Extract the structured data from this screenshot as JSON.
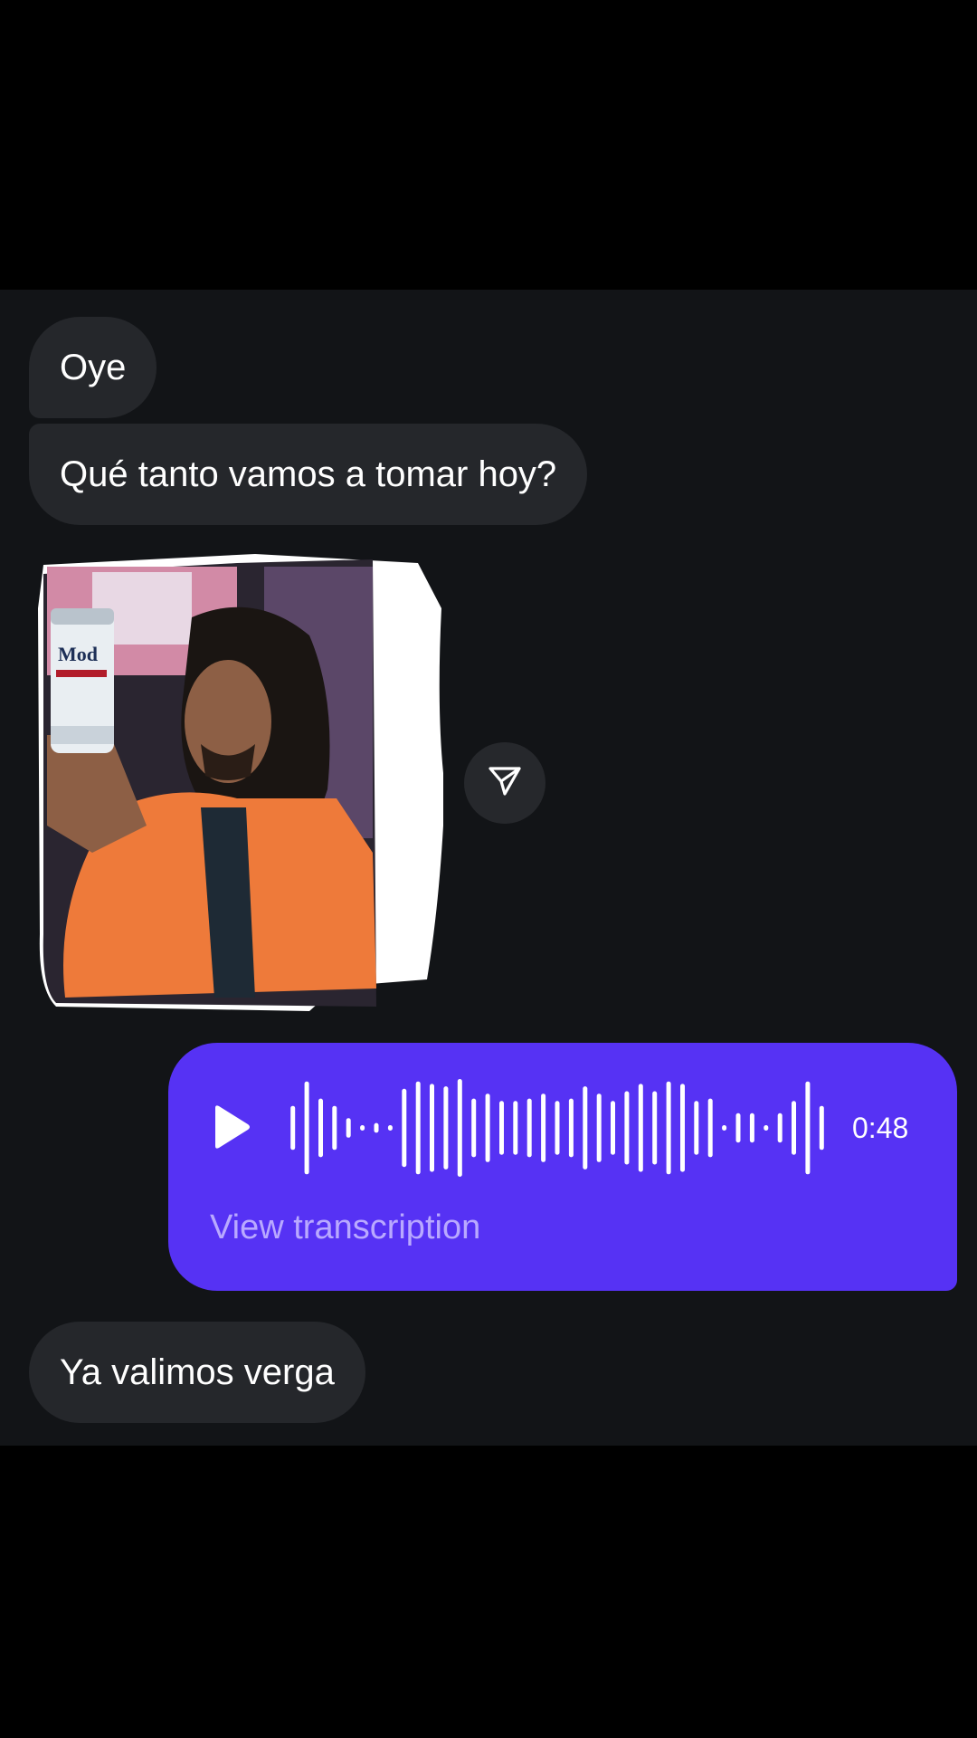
{
  "messages": {
    "first": "Oye",
    "second": "Qué tanto vamos a tomar hoy?",
    "last": "Ya valimos verga"
  },
  "sticker": {
    "can_label": "Modelo"
  },
  "share": {
    "icon": "send-icon"
  },
  "voice_message": {
    "duration": "0:48",
    "transcription_link": "View transcription",
    "play_icon": "play-icon",
    "waveform": [
      0.45,
      0.95,
      0.6,
      0.45,
      0.2,
      0.05,
      0.1,
      0.05,
      0.8,
      0.95,
      0.9,
      0.85,
      1.0,
      0.6,
      0.7,
      0.55,
      0.55,
      0.6,
      0.7,
      0.55,
      0.6,
      0.85,
      0.7,
      0.55,
      0.75,
      0.9,
      0.75,
      0.95,
      0.9,
      0.55,
      0.6,
      0.05,
      0.3,
      0.3,
      0.05,
      0.3,
      0.55,
      0.95,
      0.45
    ]
  },
  "colors": {
    "background": "#121417",
    "incoming_bubble": "#25272b",
    "outgoing_bubble": "#5632f4",
    "link": "#b9a9ff"
  }
}
